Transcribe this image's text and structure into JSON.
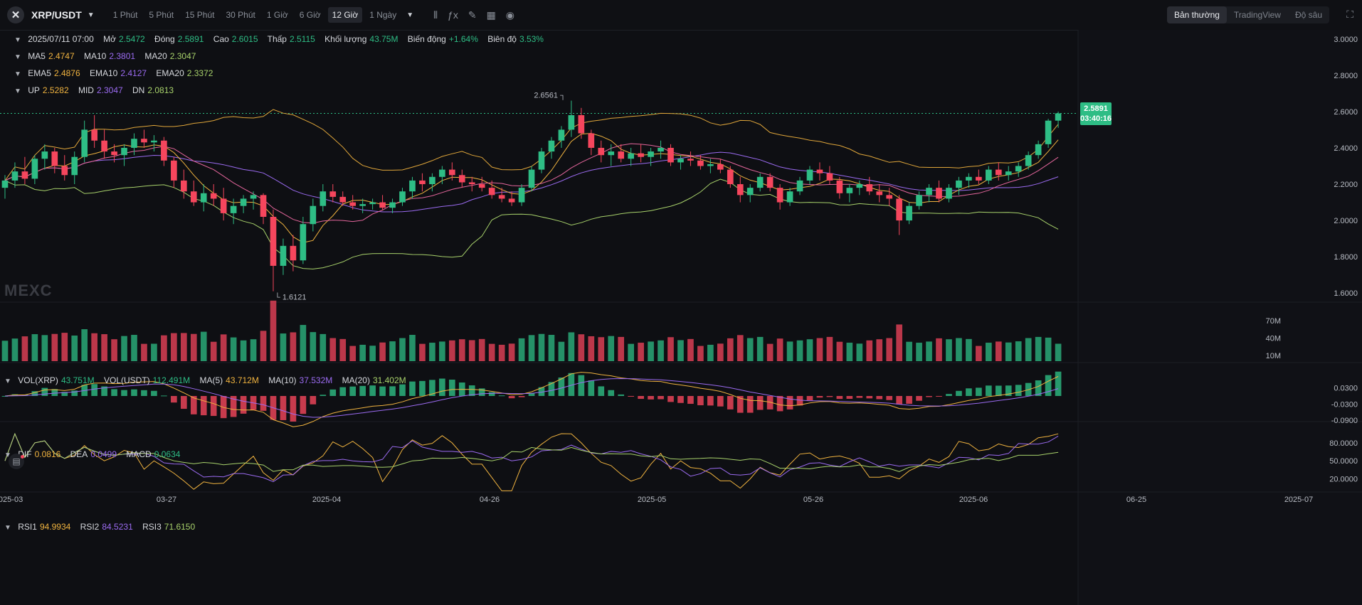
{
  "toolbar": {
    "symbol": "XRP/USDT",
    "intervals": [
      "1 Phút",
      "5 Phút",
      "15 Phút",
      "30 Phút",
      "1 Giờ",
      "6 Giờ",
      "12 Giờ",
      "1 Ngày"
    ],
    "active_interval": "12 Giờ",
    "views": [
      "Bản thường",
      "TradingView",
      "Độ sâu"
    ],
    "active_view": "Bản thường"
  },
  "ohlc": {
    "time": "2025/07/11 07:00",
    "open_label": "Mở",
    "open": "2.5472",
    "close_label": "Đóng",
    "close": "2.5891",
    "high_label": "Cao",
    "high": "2.6015",
    "low_label": "Thấp",
    "low": "2.5115",
    "volume_label": "Khối lượng",
    "volume": "43.75M",
    "change_label": "Biến động",
    "change": "+1.64%",
    "amplitude_label": "Biên độ",
    "amplitude": "3.53%"
  },
  "ma": {
    "ma5_label": "MA5",
    "ma5": "2.4747",
    "ma10_label": "MA10",
    "ma10": "2.3801",
    "ma20_label": "MA20",
    "ma20": "2.3047"
  },
  "ema": {
    "ema5_label": "EMA5",
    "ema5": "2.4876",
    "ema10_label": "EMA10",
    "ema10": "2.4127",
    "ema20_label": "EMA20",
    "ema20": "2.3372"
  },
  "boll": {
    "up_label": "UP",
    "up": "2.5282",
    "mid_label": "MID",
    "mid": "2.3047",
    "dn_label": "DN",
    "dn": "2.0813"
  },
  "vol": {
    "vol_xrp_label": "VOL(XRP)",
    "vol_xrp": "43.751M",
    "vol_usdt_label": "VOL(USDT)",
    "vol_usdt": "112.491M",
    "ma5_label": "MA(5)",
    "ma5": "43.712M",
    "ma10_label": "MA(10)",
    "ma10": "37.532M",
    "ma20_label": "MA(20)",
    "ma20": "31.402M"
  },
  "macd": {
    "dif_label": "DIF",
    "dif": "0.0816",
    "dea_label": "DEA",
    "dea": "0.0499",
    "macd_label": "MACD",
    "macd": "0.0634"
  },
  "rsi": {
    "rsi1_label": "RSI1",
    "rsi1": "94.9934",
    "rsi2_label": "RSI2",
    "rsi2": "84.5231",
    "rsi3_label": "RSI3",
    "rsi3": "71.6150"
  },
  "price_tag": {
    "price": "2.5891",
    "countdown": "03:40:16"
  },
  "watermark": "MEXC",
  "colors": {
    "up": "#2ebd85",
    "down": "#f6465d",
    "bg": "#0e0f13",
    "ma5": "#f0b33f",
    "ma10": "#9b6bf1",
    "ma20": "#a8d26b"
  },
  "chart_data": {
    "type": "candlestick",
    "price_axis": [
      "3.0000",
      "2.8000",
      "2.6000",
      "2.4000",
      "2.2000",
      "2.0000",
      "1.8000",
      "1.6000"
    ],
    "price_ylim": [
      1.55,
      3.05
    ],
    "vol_axis": [
      "70M",
      "40M",
      "10M"
    ],
    "macd_axis": [
      "0.0300",
      "-0.0300",
      "-0.0900"
    ],
    "rsi_axis": [
      "80.0000",
      "50.0000",
      "20.0000"
    ],
    "x_labels": [
      "2025-03",
      "03-27",
      "2025-04",
      "04-26",
      "2025-05",
      "05-26",
      "2025-06",
      "06-25",
      "2025-07"
    ],
    "max_label": "2.6561",
    "min_label": "1.6121",
    "candles": [
      [
        2.18,
        2.25,
        2.12,
        2.22
      ],
      [
        2.22,
        2.32,
        2.18,
        2.27
      ],
      [
        2.27,
        2.35,
        2.2,
        2.23
      ],
      [
        2.23,
        2.36,
        2.2,
        2.34
      ],
      [
        2.34,
        2.42,
        2.28,
        2.38
      ],
      [
        2.38,
        2.4,
        2.26,
        2.3
      ],
      [
        2.3,
        2.36,
        2.22,
        2.25
      ],
      [
        2.25,
        2.38,
        2.2,
        2.35
      ],
      [
        2.35,
        2.55,
        2.32,
        2.5
      ],
      [
        2.5,
        2.58,
        2.4,
        2.44
      ],
      [
        2.44,
        2.5,
        2.34,
        2.38
      ],
      [
        2.38,
        2.42,
        2.32,
        2.36
      ],
      [
        2.36,
        2.42,
        2.3,
        2.4
      ],
      [
        2.4,
        2.48,
        2.36,
        2.45
      ],
      [
        2.45,
        2.5,
        2.4,
        2.43
      ],
      [
        2.43,
        2.47,
        2.38,
        2.44
      ],
      [
        2.44,
        2.46,
        2.3,
        2.33
      ],
      [
        2.33,
        2.35,
        2.18,
        2.22
      ],
      [
        2.22,
        2.28,
        2.12,
        2.16
      ],
      [
        2.16,
        2.22,
        2.08,
        2.1
      ],
      [
        2.1,
        2.2,
        2.05,
        2.15
      ],
      [
        2.15,
        2.2,
        2.08,
        2.12
      ],
      [
        2.12,
        2.18,
        2.0,
        2.04
      ],
      [
        2.04,
        2.12,
        1.98,
        2.08
      ],
      [
        2.08,
        2.14,
        2.04,
        2.12
      ],
      [
        2.12,
        2.16,
        2.06,
        2.14
      ],
      [
        2.14,
        2.15,
        1.98,
        2.02
      ],
      [
        2.02,
        2.06,
        1.61,
        1.75
      ],
      [
        1.75,
        1.9,
        1.7,
        1.86
      ],
      [
        1.86,
        1.92,
        1.72,
        1.78
      ],
      [
        1.78,
        2.02,
        1.76,
        1.98
      ],
      [
        1.98,
        2.12,
        1.94,
        2.08
      ],
      [
        2.08,
        2.2,
        2.05,
        2.16
      ],
      [
        2.16,
        2.2,
        2.1,
        2.13
      ],
      [
        2.13,
        2.16,
        2.08,
        2.1
      ],
      [
        2.1,
        2.14,
        2.06,
        2.08
      ],
      [
        2.08,
        2.12,
        2.04,
        2.09
      ],
      [
        2.09,
        2.12,
        2.06,
        2.1
      ],
      [
        2.1,
        2.14,
        2.06,
        2.07
      ],
      [
        2.07,
        2.12,
        2.04,
        2.1
      ],
      [
        2.1,
        2.18,
        2.08,
        2.16
      ],
      [
        2.16,
        2.24,
        2.12,
        2.22
      ],
      [
        2.22,
        2.26,
        2.16,
        2.2
      ],
      [
        2.2,
        2.26,
        2.16,
        2.24
      ],
      [
        2.24,
        2.3,
        2.2,
        2.28
      ],
      [
        2.28,
        2.32,
        2.22,
        2.25
      ],
      [
        2.25,
        2.28,
        2.18,
        2.21
      ],
      [
        2.21,
        2.24,
        2.16,
        2.2
      ],
      [
        2.2,
        2.24,
        2.16,
        2.18
      ],
      [
        2.18,
        2.22,
        2.12,
        2.14
      ],
      [
        2.14,
        2.18,
        2.1,
        2.12
      ],
      [
        2.12,
        2.16,
        2.08,
        2.1
      ],
      [
        2.1,
        2.2,
        2.08,
        2.18
      ],
      [
        2.18,
        2.3,
        2.16,
        2.28
      ],
      [
        2.28,
        2.4,
        2.26,
        2.38
      ],
      [
        2.38,
        2.46,
        2.34,
        2.44
      ],
      [
        2.44,
        2.52,
        2.4,
        2.5
      ],
      [
        2.5,
        2.66,
        2.46,
        2.58
      ],
      [
        2.58,
        2.62,
        2.45,
        2.48
      ],
      [
        2.48,
        2.5,
        2.36,
        2.4
      ],
      [
        2.4,
        2.44,
        2.32,
        2.36
      ],
      [
        2.36,
        2.42,
        2.3,
        2.38
      ],
      [
        2.38,
        2.42,
        2.32,
        2.34
      ],
      [
        2.34,
        2.4,
        2.3,
        2.37
      ],
      [
        2.37,
        2.42,
        2.32,
        2.35
      ],
      [
        2.35,
        2.4,
        2.3,
        2.38
      ],
      [
        2.38,
        2.44,
        2.34,
        2.4
      ],
      [
        2.4,
        2.42,
        2.3,
        2.32
      ],
      [
        2.32,
        2.36,
        2.28,
        2.34
      ],
      [
        2.34,
        2.38,
        2.3,
        2.33
      ],
      [
        2.33,
        2.36,
        2.28,
        2.3
      ],
      [
        2.3,
        2.34,
        2.26,
        2.31
      ],
      [
        2.31,
        2.34,
        2.26,
        2.28
      ],
      [
        2.28,
        2.3,
        2.18,
        2.2
      ],
      [
        2.2,
        2.24,
        2.1,
        2.14
      ],
      [
        2.14,
        2.2,
        2.1,
        2.18
      ],
      [
        2.18,
        2.26,
        2.16,
        2.24
      ],
      [
        2.24,
        2.26,
        2.16,
        2.18
      ],
      [
        2.18,
        2.2,
        2.06,
        2.1
      ],
      [
        2.1,
        2.18,
        2.08,
        2.16
      ],
      [
        2.16,
        2.24,
        2.14,
        2.22
      ],
      [
        2.22,
        2.3,
        2.2,
        2.28
      ],
      [
        2.28,
        2.32,
        2.22,
        2.26
      ],
      [
        2.26,
        2.3,
        2.2,
        2.22
      ],
      [
        2.22,
        2.24,
        2.12,
        2.15
      ],
      [
        2.15,
        2.2,
        2.1,
        2.18
      ],
      [
        2.18,
        2.22,
        2.14,
        2.2
      ],
      [
        2.2,
        2.24,
        2.14,
        2.16
      ],
      [
        2.16,
        2.2,
        2.1,
        2.14
      ],
      [
        2.14,
        2.18,
        2.08,
        2.12
      ],
      [
        2.12,
        2.14,
        1.92,
        2.0
      ],
      [
        2.0,
        2.1,
        1.98,
        2.08
      ],
      [
        2.08,
        2.16,
        2.06,
        2.14
      ],
      [
        2.14,
        2.2,
        2.1,
        2.18
      ],
      [
        2.18,
        2.22,
        2.1,
        2.12
      ],
      [
        2.12,
        2.2,
        2.1,
        2.18
      ],
      [
        2.18,
        2.24,
        2.14,
        2.22
      ],
      [
        2.22,
        2.26,
        2.18,
        2.24
      ],
      [
        2.24,
        2.28,
        2.2,
        2.22
      ],
      [
        2.22,
        2.3,
        2.2,
        2.28
      ],
      [
        2.28,
        2.32,
        2.22,
        2.25
      ],
      [
        2.25,
        2.3,
        2.22,
        2.27
      ],
      [
        2.27,
        2.32,
        2.24,
        2.3
      ],
      [
        2.3,
        2.38,
        2.28,
        2.36
      ],
      [
        2.36,
        2.44,
        2.34,
        2.42
      ],
      [
        2.42,
        2.56,
        2.4,
        2.55
      ],
      [
        2.55,
        2.6,
        2.51,
        2.59
      ]
    ]
  }
}
